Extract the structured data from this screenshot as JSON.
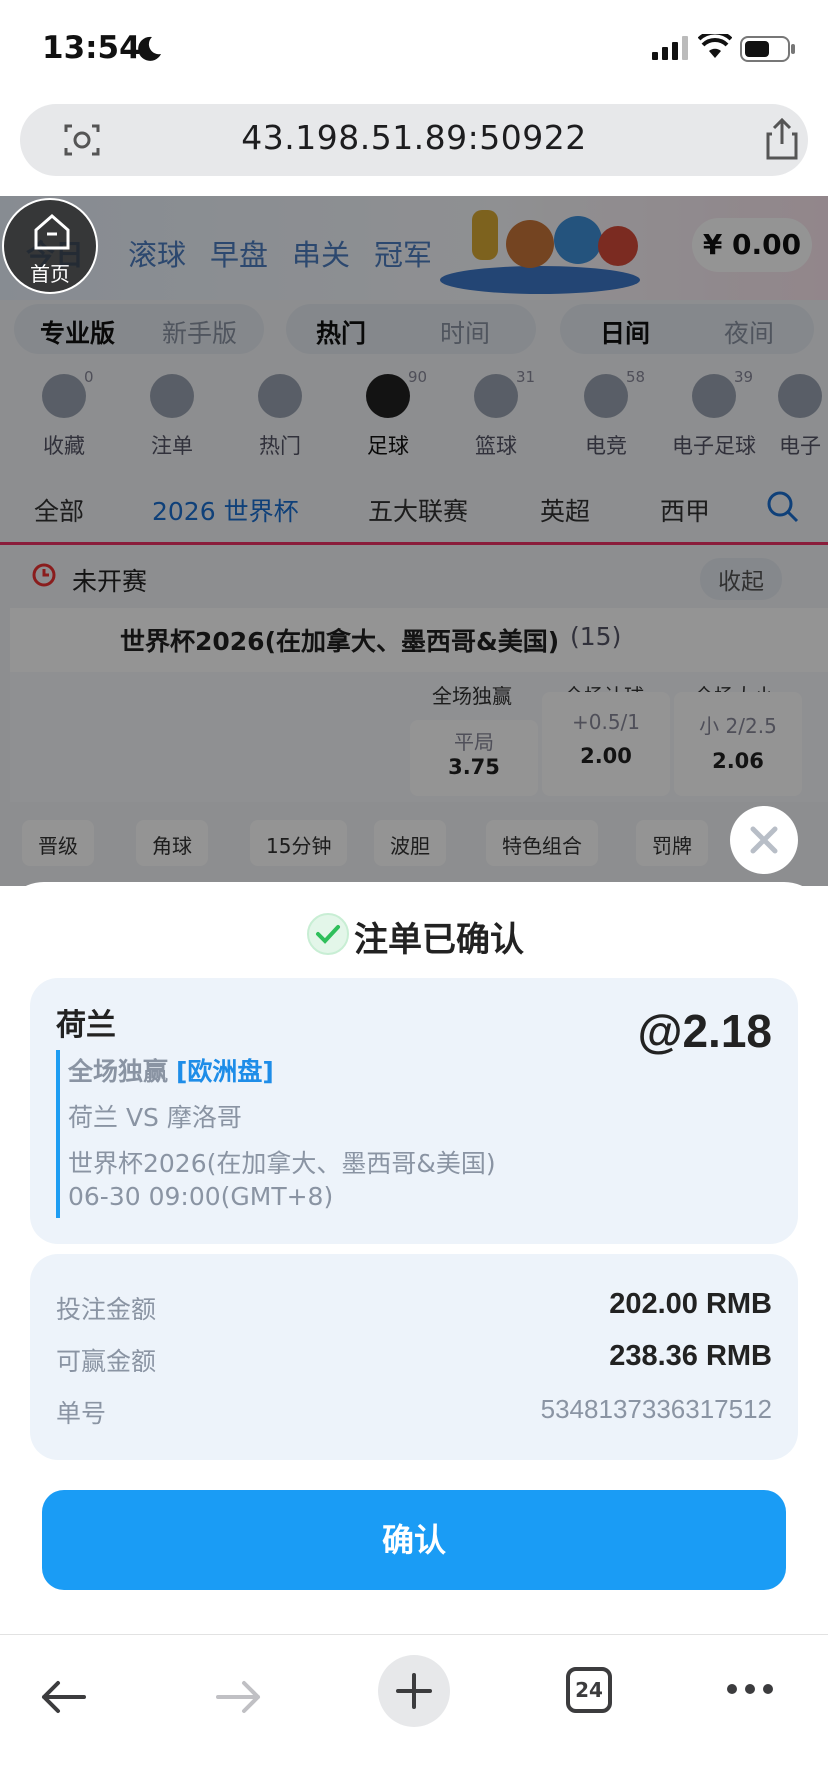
{
  "status": {
    "time": "13:54"
  },
  "browser": {
    "url": "43.198.51.89:50922",
    "tab_count": "24"
  },
  "page": {
    "nav_tabs": [
      "今日",
      "滚球",
      "早盘",
      "串关",
      "冠军"
    ],
    "balance": "¥ 0.00",
    "mode": {
      "pro": "专业版",
      "novice": "新手版"
    },
    "sort": {
      "hot": "热门",
      "time": "时间"
    },
    "theme": {
      "day": "日间",
      "night": "夜间"
    },
    "sports": [
      {
        "label": "收藏",
        "count": "0"
      },
      {
        "label": "注单",
        "count": ""
      },
      {
        "label": "热门",
        "count": ""
      },
      {
        "label": "足球",
        "count": "90"
      },
      {
        "label": "篮球",
        "count": "31"
      },
      {
        "label": "电竞",
        "count": "58"
      },
      {
        "label": "电子足球",
        "count": "39"
      },
      {
        "label": "电子",
        "count": ""
      }
    ],
    "leagues": [
      "全部",
      "2026 世界杯",
      "五大联赛",
      "英超",
      "西甲"
    ],
    "section": "未开赛",
    "collapse": "收起",
    "match_league": "世界杯2026(在加拿大、墨西哥&美国)",
    "match_count": "(15)",
    "odds_headers": [
      "全场独赢",
      "全场让球",
      "全场大小"
    ],
    "odds": {
      "draw_label": "平局",
      "draw_value": "3.75",
      "handicap_label": "+0.5/1",
      "handicap_value": "2.00",
      "total_label": "小 2/2.5",
      "total_value": "2.06"
    },
    "chips": [
      "晋级",
      "角球",
      "15分钟",
      "波胆",
      "特色组合",
      "罚牌"
    ]
  },
  "home_button": {
    "label": "首页"
  },
  "sheet": {
    "title": "注单已确认",
    "selection": "荷兰",
    "odds": "@2.18",
    "bet_type": "全场独赢",
    "market": "[欧洲盘]",
    "teams": "荷兰 VS 摩洛哥",
    "league": "世界杯2026(在加拿大、墨西哥&美国)",
    "datetime": "06-30 09:00(GMT+8)",
    "stake_label": "投注金额",
    "stake_value": "202.00 RMB",
    "win_label": "可赢金额",
    "win_value": "238.36 RMB",
    "id_label": "单号",
    "id_value": "5348137336317512",
    "confirm": "确认"
  },
  "colors": {
    "accent": "#1a9cf5",
    "market": "#1e8de8",
    "success": "#2fbf5b"
  }
}
